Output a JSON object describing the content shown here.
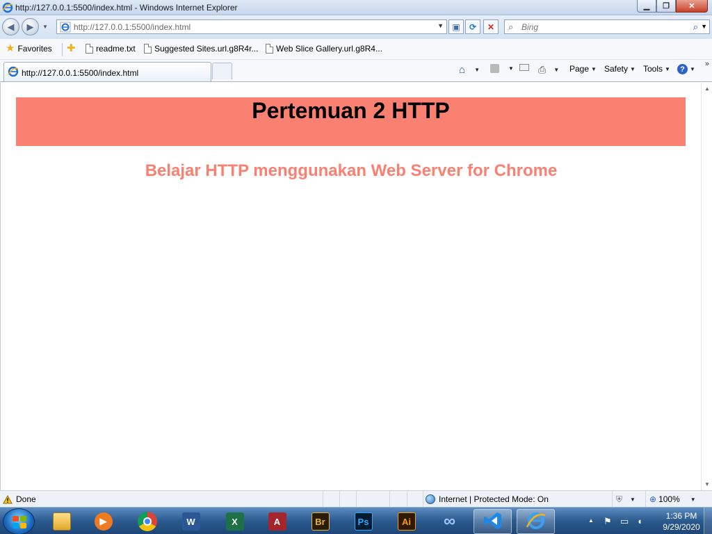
{
  "window": {
    "title": "http://127.0.0.1:5500/index.html - Windows Internet Explorer",
    "minimize_glyph": "▁",
    "maximize_glyph": "❐",
    "close_glyph": "✕"
  },
  "address_bar": {
    "url": "http://127.0.0.1:5500/index.html"
  },
  "search": {
    "placeholder": "Bing"
  },
  "favorites_bar": {
    "favorites_label": "Favorites",
    "items": [
      {
        "label": "readme.txt",
        "icon": "document-icon"
      },
      {
        "label": "Suggested Sites.url.g8R4r...",
        "icon": "document-icon"
      },
      {
        "label": "Web Slice Gallery.url.g8R4...",
        "icon": "document-icon"
      }
    ]
  },
  "tabs": [
    {
      "label": "http://127.0.0.1:5500/index.html",
      "active": true
    }
  ],
  "command_bar": {
    "page_label": "Page",
    "safety_label": "Safety",
    "tools_label": "Tools",
    "help_glyph": "?"
  },
  "page": {
    "heading": "Pertemuan 2 HTTP",
    "subheading": "Belajar HTTP menggunakan Web Server for Chrome",
    "banner_color": "#fa8072",
    "subheading_color": "#fa8072"
  },
  "status_bar": {
    "status_text": "Done",
    "zone_text": "Internet | Protected Mode: On",
    "zoom_text": "100%"
  },
  "taskbar": {
    "apps": [
      {
        "name": "windows-explorer",
        "glyph": ""
      },
      {
        "name": "media-player",
        "glyph": "▶"
      },
      {
        "name": "chrome",
        "glyph": ""
      },
      {
        "name": "word",
        "glyph": "W"
      },
      {
        "name": "excel",
        "glyph": "X"
      },
      {
        "name": "access",
        "glyph": "A"
      },
      {
        "name": "bridge",
        "glyph": "Br"
      },
      {
        "name": "photoshop",
        "glyph": "Ps"
      },
      {
        "name": "illustrator",
        "glyph": "Ai"
      },
      {
        "name": "app-infinity",
        "glyph": "∞"
      },
      {
        "name": "vscode",
        "glyph": ""
      },
      {
        "name": "internet-explorer",
        "glyph": "e"
      }
    ],
    "clock_time": "1:36 PM",
    "clock_date": "9/29/2020"
  }
}
